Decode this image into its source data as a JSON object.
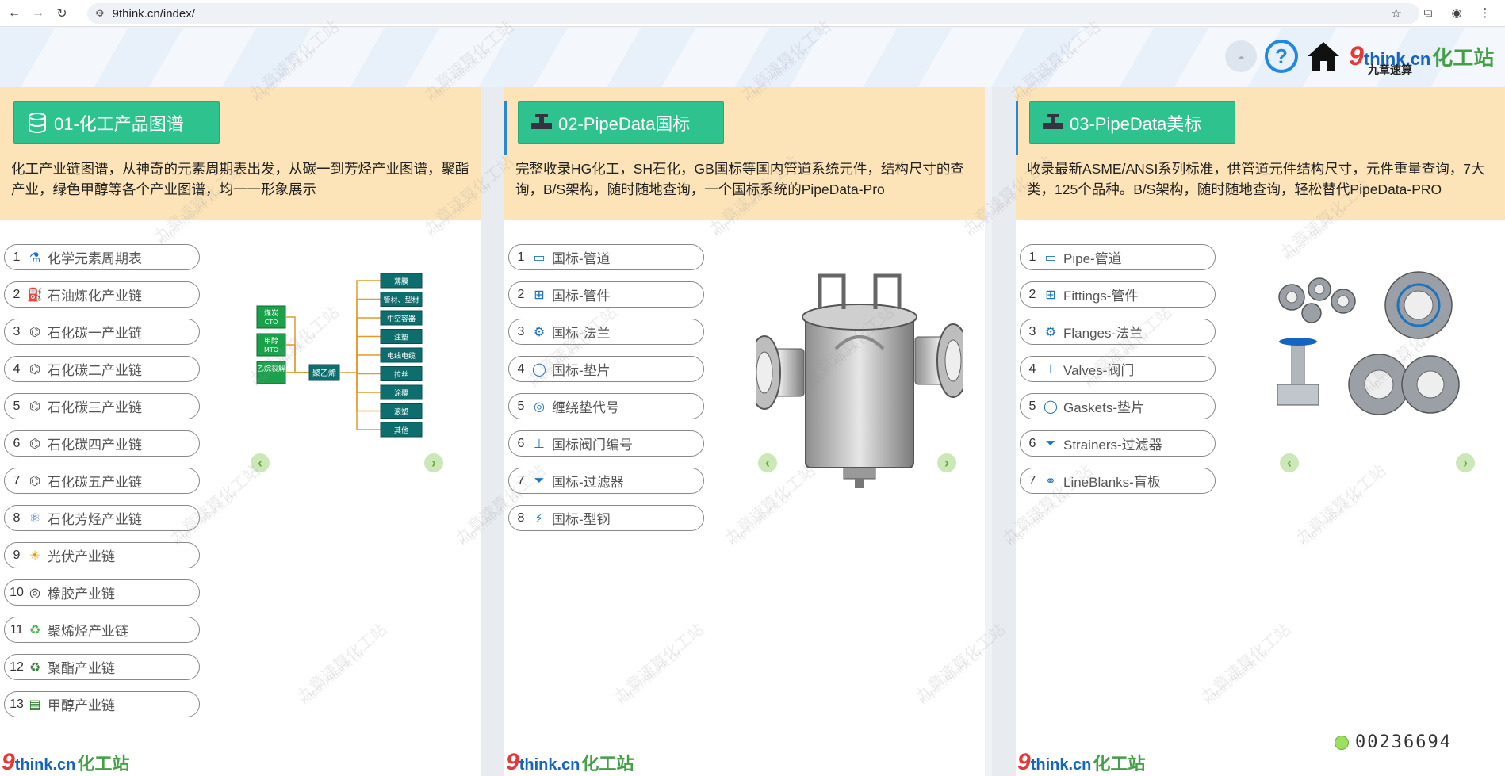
{
  "browser": {
    "url": "9think.cn/index/"
  },
  "header": {
    "logo": {
      "nine": "9",
      "think": "think",
      "cn": ".cn",
      "hua": "化工站",
      "sub": "九章速算"
    }
  },
  "columns": [
    {
      "title": "01-化工产品图谱",
      "desc": "化工产业链图谱，从神奇的元素周期表出发，从碳一到芳烃产业图谱，聚酯产业，绿色甲醇等各个产业图谱，均一一形象展示",
      "items": [
        {
          "num": "1",
          "label": "化学元素周期表"
        },
        {
          "num": "2",
          "label": "石油炼化产业链"
        },
        {
          "num": "3",
          "label": "石化碳一产业链"
        },
        {
          "num": "4",
          "label": "石化碳二产业链"
        },
        {
          "num": "5",
          "label": "石化碳三产业链"
        },
        {
          "num": "6",
          "label": "石化碳四产业链"
        },
        {
          "num": "7",
          "label": "石化碳五产业链"
        },
        {
          "num": "8",
          "label": "石化芳烃产业链"
        },
        {
          "num": "9",
          "label": "光伏产业链"
        },
        {
          "num": "10",
          "label": "橡胶产业链"
        },
        {
          "num": "11",
          "label": "聚烯烃产业链"
        },
        {
          "num": "12",
          "label": "聚酯产业链"
        },
        {
          "num": "13",
          "label": "甲醇产业链"
        }
      ],
      "diagram": {
        "left": [
          {
            "t": "煤炭",
            "s": "CTO"
          },
          {
            "t": "甲醇",
            "s": "MTO"
          },
          {
            "t": "乙烷裂解",
            "s": ""
          }
        ],
        "center": "聚乙烯",
        "right": [
          "薄膜",
          "管材、型材",
          "中空容器",
          "注塑",
          "电线电缆",
          "拉丝",
          "涂覆",
          "滚塑",
          "其他"
        ]
      }
    },
    {
      "title": "02-PipeData国标",
      "desc": "完整收录HG化工，SH石化，GB国标等国内管道系统元件，结构尺寸的查询，B/S架构，随时随地查询，一个国标系统的PipeData-Pro",
      "items": [
        {
          "num": "1",
          "label": "国标-管道"
        },
        {
          "num": "2",
          "label": "国标-管件"
        },
        {
          "num": "3",
          "label": "国标-法兰"
        },
        {
          "num": "4",
          "label": "国标-垫片"
        },
        {
          "num": "5",
          "label": "缠绕垫代号"
        },
        {
          "num": "6",
          "label": "国标阀门编号"
        },
        {
          "num": "7",
          "label": "国标-过滤器"
        },
        {
          "num": "8",
          "label": "国标-型钢"
        }
      ]
    },
    {
      "title": "03-PipeData美标",
      "desc": "收录最新ASME/ANSI系列标准，供管道元件结构尺寸，元件重量查询，7大类，125个品种。B/S架构，随时随地查询，轻松替代PipeData-PRO",
      "items": [
        {
          "num": "1",
          "label": "Pipe-管道"
        },
        {
          "num": "2",
          "label": "Fittings-管件"
        },
        {
          "num": "3",
          "label": "Flanges-法兰"
        },
        {
          "num": "4",
          "label": "Valves-阀门"
        },
        {
          "num": "5",
          "label": "Gaskets-垫片"
        },
        {
          "num": "6",
          "label": "Strainers-过滤器"
        },
        {
          "num": "7",
          "label": "LineBlanks-盲板"
        }
      ]
    }
  ],
  "counter": "00236694",
  "watermark": {
    "cn": "九章速算化工站",
    "url": "https://9think.cn"
  }
}
